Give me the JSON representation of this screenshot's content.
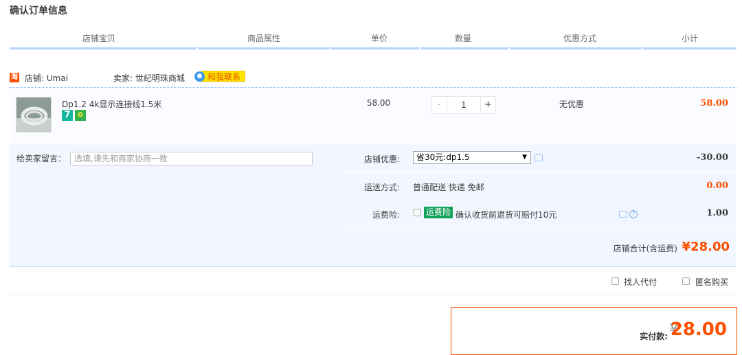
{
  "page_title": "确认订单信息",
  "header": {
    "columns": [
      "店铺宝贝",
      "商品属性",
      "单价",
      "数量",
      "优惠方式",
      "小计"
    ]
  },
  "shop": {
    "icon_text": "淘",
    "name": "店铺: Umai",
    "seller": "卖家: 世纪明珠商城",
    "contact_label": "和我联系"
  },
  "item": {
    "title": "Dp1.2 4k显示连接线1.5米",
    "badge_7": "7",
    "unit_price": "58.00",
    "quantity": "1",
    "qty_minus": "-",
    "qty_plus": "+",
    "promo": "无优惠",
    "subtotal": "58.00"
  },
  "message": {
    "label": "给卖家留言：",
    "placeholder": "选填,请先和商家协商一致"
  },
  "shop_discount": {
    "label": "店铺优惠:",
    "selected": "省30元:dp1.5",
    "amount": "-30.00"
  },
  "shipping": {
    "label": "运送方式:",
    "value": "普通配送 快递 免邮",
    "amount": "0.00"
  },
  "insurance": {
    "label": "运费险:",
    "badge": "运费险",
    "text": "确认收货前退货可赔付10元",
    "amount": "1.00"
  },
  "shop_total": {
    "label": "店铺合计(含运费)",
    "amount": "¥28.00"
  },
  "extras": {
    "proxy_pay": "找人代付",
    "anonymous": "匿名购买"
  },
  "payment": {
    "label": "实付款:",
    "yen": "¥",
    "amount": "28.00"
  },
  "colors": {
    "accent": "#ff5000",
    "header_line": "#b2d1ff",
    "panel_bg": "#f2f7ff"
  }
}
